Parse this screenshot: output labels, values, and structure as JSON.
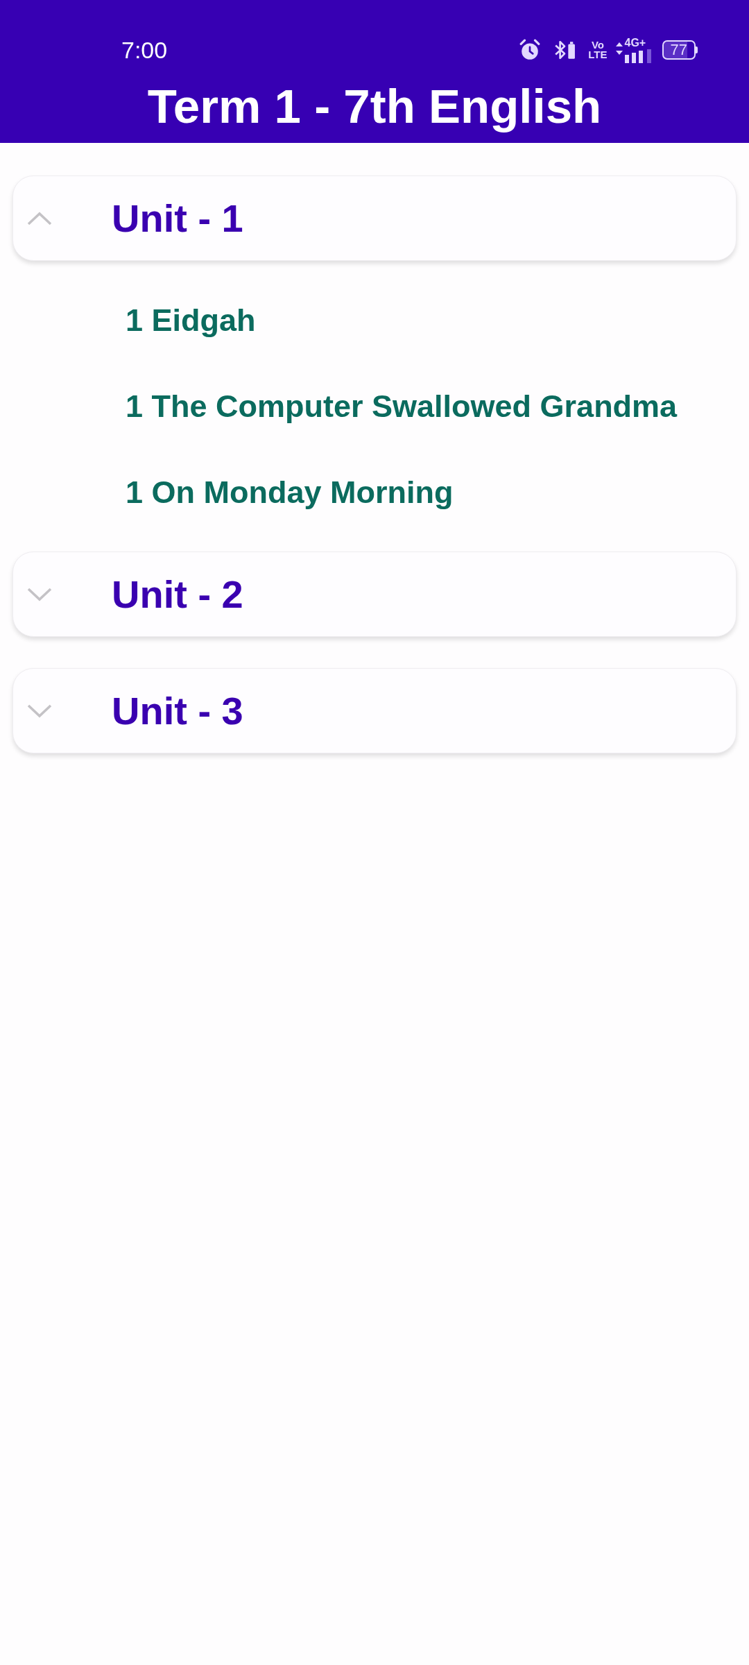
{
  "status_bar": {
    "time": "7:00",
    "volte": "Vo LTE",
    "network": "4G+",
    "battery": "77"
  },
  "app_bar": {
    "title": "Term 1 - 7th English"
  },
  "units": [
    {
      "title": "Unit - 1",
      "expanded": true,
      "lessons": [
        "1 Eidgah",
        "1 The Computer Swallowed Grandma",
        "1 On Monday Morning"
      ]
    },
    {
      "title": "Unit - 2",
      "expanded": false
    },
    {
      "title": "Unit - 3",
      "expanded": false
    }
  ]
}
